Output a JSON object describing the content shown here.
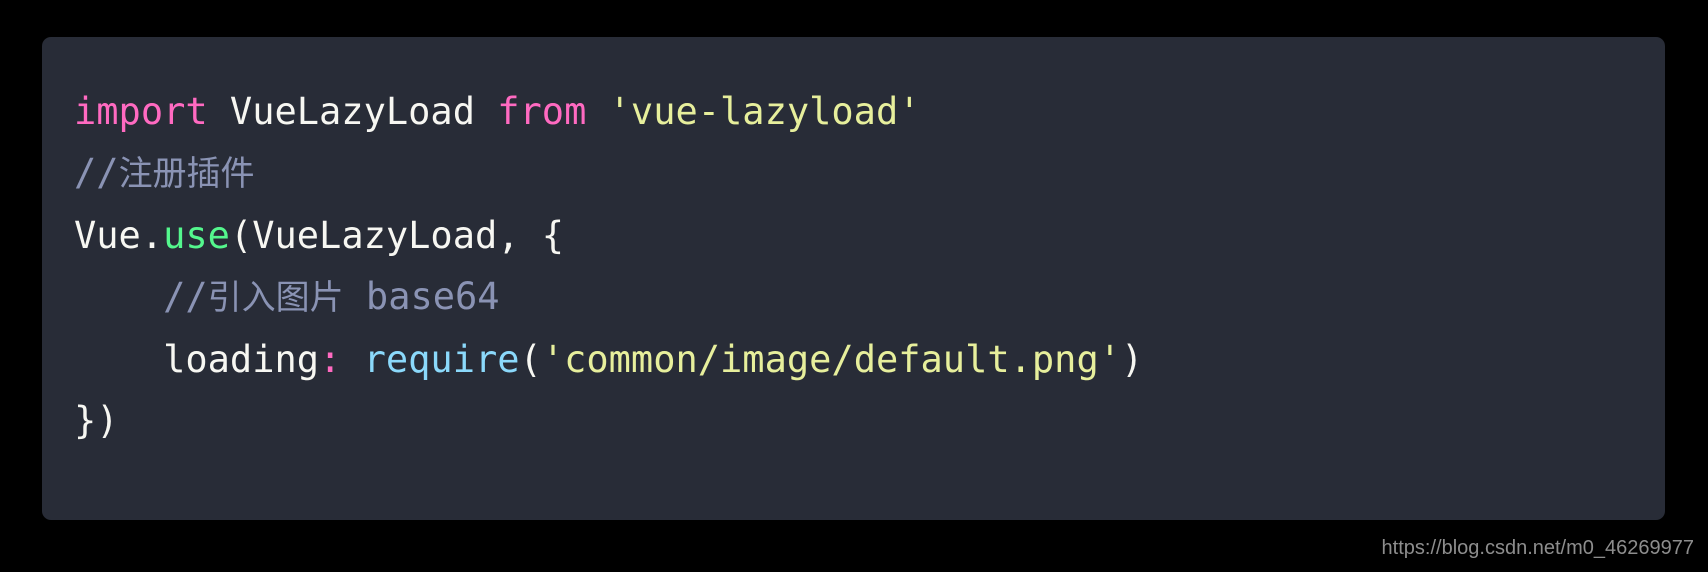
{
  "theme": {
    "page_background": "#000000",
    "code_background": "#282c37",
    "default_text": "#f7f7f2",
    "keyword_color": "#ff6ac1",
    "string_color": "#e7ef9c",
    "comment_color": "#8a93b4",
    "method_color": "#54f78d",
    "function_color": "#8bd9fb",
    "punctuation_color": "#ff6ac1",
    "watermark_color": "#8d8d8d"
  },
  "code": {
    "language": "javascript",
    "full_text": "import VueLazyLoad from 'vue-lazyload'\n//注册插件\nVue.use(VueLazyLoad, {\n    //引入图片 base64\n    loading: require('common/image/default.png')\n})",
    "lines": [
      {
        "number": 1,
        "tokens": [
          {
            "text": "import",
            "type": "keyword"
          },
          {
            "text": " VueLazyLoad ",
            "type": "plain"
          },
          {
            "text": "from",
            "type": "keyword"
          },
          {
            "text": " ",
            "type": "plain"
          },
          {
            "text": "'vue-lazyload'",
            "type": "string"
          }
        ]
      },
      {
        "number": 2,
        "tokens": [
          {
            "text": "//注册插件",
            "type": "comment"
          }
        ]
      },
      {
        "number": 3,
        "tokens": [
          {
            "text": "Vue.",
            "type": "plain"
          },
          {
            "text": "use",
            "type": "method"
          },
          {
            "text": "(VueLazyLoad, {",
            "type": "plain"
          }
        ]
      },
      {
        "number": 4,
        "tokens": [
          {
            "text": "    //引入图片 base64",
            "type": "comment"
          }
        ]
      },
      {
        "number": 5,
        "tokens": [
          {
            "text": "    loading",
            "type": "plain"
          },
          {
            "text": ":",
            "type": "punct"
          },
          {
            "text": " ",
            "type": "plain"
          },
          {
            "text": "require",
            "type": "function"
          },
          {
            "text": "(",
            "type": "plain"
          },
          {
            "text": "'common/image/default.png'",
            "type": "string"
          },
          {
            "text": ")",
            "type": "plain"
          }
        ]
      },
      {
        "number": 6,
        "tokens": [
          {
            "text": "})",
            "type": "plain"
          }
        ]
      }
    ]
  },
  "watermark": {
    "text": "https://blog.csdn.net/m0_46269977"
  }
}
